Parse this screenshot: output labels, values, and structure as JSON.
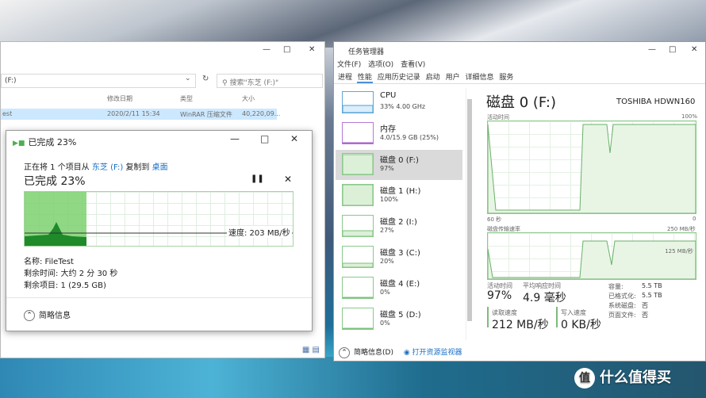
{
  "explorer": {
    "address": "(F:)",
    "search_placeholder": "搜索\"东芝 (F:)\"",
    "columns": [
      "修改日期",
      "类型",
      "大小"
    ],
    "row": {
      "name": "est",
      "date": "2020/2/11 15:34",
      "type": "WinRAR 压缩文件",
      "size": "40,220,09..."
    }
  },
  "copy_dialog": {
    "title": "已完成 23%",
    "line_prefix": "正在将 1 个项目从",
    "source": "东芝 (F:)",
    "line_mid": "复制到",
    "dest": "桌面",
    "big_status": "已完成 23%",
    "progress": 0.23,
    "speed": "速度: 203 MB/秒",
    "name_line": "名称: FileTest",
    "time_line": "剩余时间: 大约 2 分 30 秒",
    "items_line": "剩余项目: 1 (29.5 GB)",
    "details_label": "简略信息"
  },
  "task_manager": {
    "title": "任务管理器",
    "menu": [
      "文件(F)",
      "选项(O)",
      "查看(V)"
    ],
    "tabs": [
      "进程",
      "性能",
      "应用历史记录",
      "启动",
      "用户",
      "详细信息",
      "服务"
    ],
    "active_tab": "性能",
    "sidebar": [
      {
        "name": "CPU",
        "value": "33% 4.00 GHz",
        "kind": "cpu"
      },
      {
        "name": "内存",
        "value": "4.0/15.9 GB (25%)",
        "kind": "mem"
      },
      {
        "name": "磁盘 0 (F:)",
        "value": "97%",
        "kind": "disk",
        "selected": true
      },
      {
        "name": "磁盘 1 (H:)",
        "value": "100%",
        "kind": "disk"
      },
      {
        "name": "磁盘 2 (I:)",
        "value": "27%",
        "kind": "disk"
      },
      {
        "name": "磁盘 3 (C:)",
        "value": "20%",
        "kind": "disk"
      },
      {
        "name": "磁盘 4 (E:)",
        "value": "0%",
        "kind": "disk"
      },
      {
        "name": "磁盘 5 (D:)",
        "value": "0%",
        "kind": "disk"
      }
    ],
    "footer_details": "简略信息(D)",
    "footer_link": "打开资源监视器",
    "disk": {
      "title": "磁盘 0 (F:)",
      "model": "TOSHIBA HDWN160",
      "active_time_label": "活动时间",
      "active_max": "100%",
      "seconds_label": "60 秒",
      "zero": "0",
      "transfer_label": "磁盘传输速率",
      "transfer_max": "250 MB/秒",
      "transfer_mid": "125 MB/秒",
      "active_lbl": "活动时间",
      "active_val": "97%",
      "resp_lbl": "平均响应时间",
      "resp_val": "4.9 毫秒",
      "read_lbl": "读取速度",
      "read_val": "212 MB/秒",
      "write_lbl": "写入速度",
      "write_val": "0 KB/秒",
      "kv": [
        {
          "k": "容量:",
          "v": "5.5 TB"
        },
        {
          "k": "已格式化:",
          "v": "5.5 TB"
        },
        {
          "k": "系统磁盘:",
          "v": "否"
        },
        {
          "k": "页面文件:",
          "v": "否"
        }
      ]
    }
  },
  "watermark": {
    "logo": "值",
    "text": "什么值得买"
  }
}
